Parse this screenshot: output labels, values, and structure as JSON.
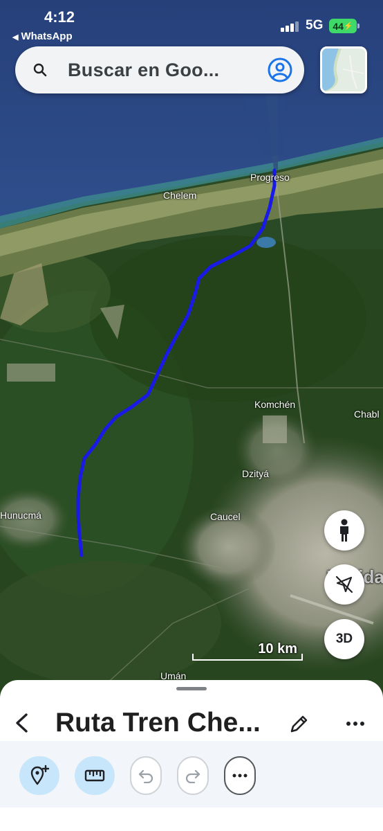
{
  "status_bar": {
    "time": "4:12",
    "back_app": "WhatsApp",
    "network": "5G",
    "battery": "44"
  },
  "search": {
    "placeholder": "Buscar en Goo...",
    "icon": "search-icon",
    "account_icon": "account-circle-icon"
  },
  "map": {
    "places": {
      "progreso": "Progreso",
      "chelem": "Chelem",
      "komchen": "Komchén",
      "chablekal": "Chabl",
      "dzitya": "Dzityá",
      "caucel": "Caucel",
      "hunucma": "Hunucmá",
      "merida": "Mérida",
      "uman": "Umán"
    },
    "scale_label": "10 km",
    "route_color": "#1a1ae6"
  },
  "fabs": {
    "street_view_icon": "pegman-icon",
    "compass_icon": "compass-off-icon",
    "three_d_label": "3D"
  },
  "sheet": {
    "title": "Ruta Tren Che...",
    "back_icon": "chevron-left-icon",
    "edit_icon": "pencil-icon",
    "more_icon": "more-horizontal-icon"
  },
  "toolbar": {
    "tools": [
      "add-point-icon",
      "ruler-icon",
      "undo-icon",
      "redo-icon",
      "more-icon"
    ]
  }
}
